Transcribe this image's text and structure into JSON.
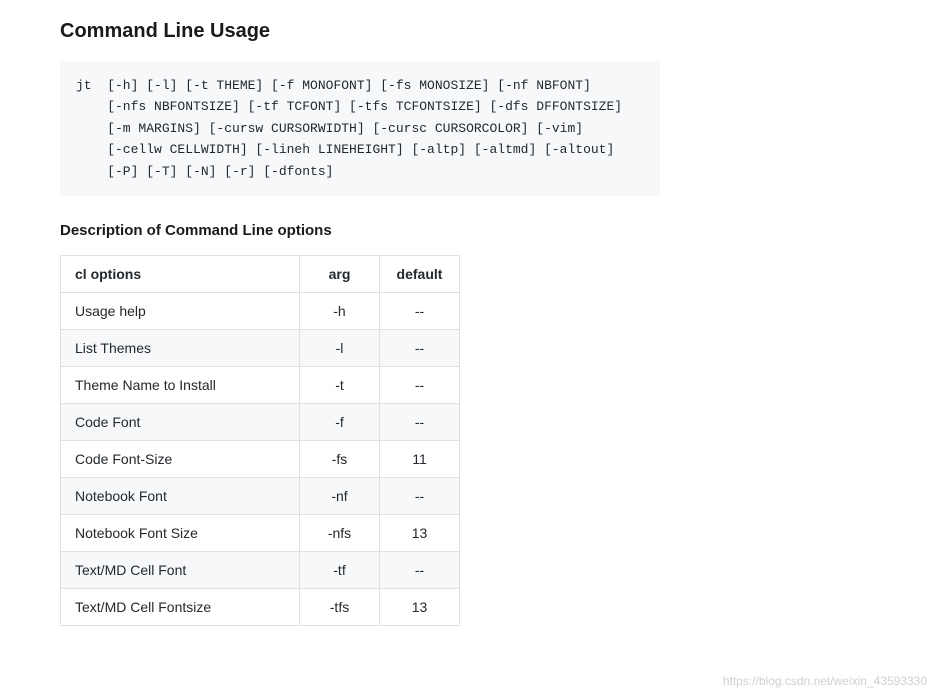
{
  "heading": "Command Line Usage",
  "code_usage": "jt  [-h] [-l] [-t THEME] [-f MONOFONT] [-fs MONOSIZE] [-nf NBFONT]\n    [-nfs NBFONTSIZE] [-tf TCFONT] [-tfs TCFONTSIZE] [-dfs DFFONTSIZE]\n    [-m MARGINS] [-cursw CURSORWIDTH] [-cursc CURSORCOLOR] [-vim]\n    [-cellw CELLWIDTH] [-lineh LINEHEIGHT] [-altp] [-altmd] [-altout]\n    [-P] [-T] [-N] [-r] [-dfonts]",
  "subheading": "Description of Command Line options",
  "table": {
    "headers": {
      "col1": "cl options",
      "col2": "arg",
      "col3": "default"
    },
    "rows": [
      {
        "opt": "Usage help",
        "arg": "-h",
        "def": "--"
      },
      {
        "opt": "List Themes",
        "arg": "-l",
        "def": "--"
      },
      {
        "opt": "Theme Name to Install",
        "arg": "-t",
        "def": "--"
      },
      {
        "opt": "Code Font",
        "arg": "-f",
        "def": "--"
      },
      {
        "opt": "Code Font-Size",
        "arg": "-fs",
        "def": "11"
      },
      {
        "opt": "Notebook Font",
        "arg": "-nf",
        "def": "--"
      },
      {
        "opt": "Notebook Font Size",
        "arg": "-nfs",
        "def": "13"
      },
      {
        "opt": "Text/MD Cell Font",
        "arg": "-tf",
        "def": "--"
      },
      {
        "opt": "Text/MD Cell Fontsize",
        "arg": "-tfs",
        "def": "13"
      }
    ]
  },
  "watermark": "https://blog.csdn.net/weixin_43593330"
}
